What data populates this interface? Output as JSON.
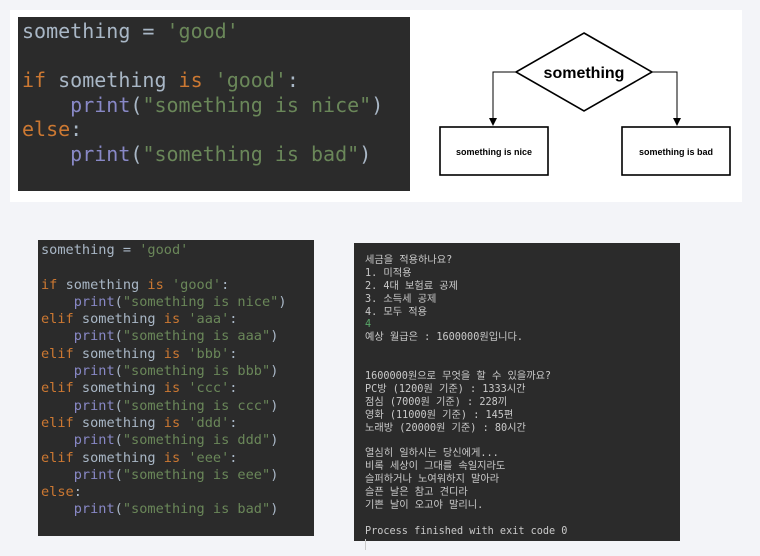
{
  "colors": {
    "keyword": "#cc7832",
    "string": "#6a8759",
    "builtin": "#8888c6",
    "text": "#a9b7c6",
    "code_background": "#2b2b2b",
    "console_input": "#59a869"
  },
  "code_simple": {
    "lines": [
      [
        [
          "plain",
          "something = "
        ],
        [
          "str",
          "'good'"
        ]
      ],
      [],
      [
        [
          "kw",
          "if "
        ],
        [
          "plain",
          "something "
        ],
        [
          "kw",
          "is "
        ],
        [
          "str",
          "'good'"
        ],
        [
          "plain",
          ":"
        ]
      ],
      [
        [
          "plain",
          "    "
        ],
        [
          "call",
          "print"
        ],
        [
          "plain",
          "("
        ],
        [
          "str",
          "\"something is nice\""
        ],
        [
          "plain",
          ")"
        ]
      ],
      [
        [
          "kw",
          "else"
        ],
        [
          "plain",
          ":"
        ]
      ],
      [
        [
          "plain",
          "    "
        ],
        [
          "call",
          "print"
        ],
        [
          "plain",
          "("
        ],
        [
          "str",
          "\"something is bad\""
        ],
        [
          "plain",
          ")"
        ]
      ]
    ]
  },
  "flowchart": {
    "decision": "something",
    "left_box": "something is nice",
    "right_box": "something is bad"
  },
  "code_elif": {
    "lines": [
      [
        [
          "plain",
          "something = "
        ],
        [
          "str",
          "'good'"
        ]
      ],
      [],
      [
        [
          "kw",
          "if "
        ],
        [
          "plain",
          "something "
        ],
        [
          "kw",
          "is "
        ],
        [
          "str",
          "'good'"
        ],
        [
          "plain",
          ":"
        ]
      ],
      [
        [
          "plain",
          "    "
        ],
        [
          "call",
          "print"
        ],
        [
          "plain",
          "("
        ],
        [
          "str",
          "\"something is nice\""
        ],
        [
          "plain",
          ")"
        ]
      ],
      [
        [
          "kw",
          "elif "
        ],
        [
          "plain",
          "something "
        ],
        [
          "kw",
          "is "
        ],
        [
          "str",
          "'aaa'"
        ],
        [
          "plain",
          ":"
        ]
      ],
      [
        [
          "plain",
          "    "
        ],
        [
          "call",
          "print"
        ],
        [
          "plain",
          "("
        ],
        [
          "str",
          "\"something is aaa\""
        ],
        [
          "plain",
          ")"
        ]
      ],
      [
        [
          "kw",
          "elif "
        ],
        [
          "plain",
          "something "
        ],
        [
          "kw",
          "is "
        ],
        [
          "str",
          "'bbb'"
        ],
        [
          "plain",
          ":"
        ]
      ],
      [
        [
          "plain",
          "    "
        ],
        [
          "call",
          "print"
        ],
        [
          "plain",
          "("
        ],
        [
          "str",
          "\"something is bbb\""
        ],
        [
          "plain",
          ")"
        ]
      ],
      [
        [
          "kw",
          "elif "
        ],
        [
          "plain",
          "something "
        ],
        [
          "kw",
          "is "
        ],
        [
          "str",
          "'ccc'"
        ],
        [
          "plain",
          ":"
        ]
      ],
      [
        [
          "plain",
          "    "
        ],
        [
          "call",
          "print"
        ],
        [
          "plain",
          "("
        ],
        [
          "str",
          "\"something is ccc\""
        ],
        [
          "plain",
          ")"
        ]
      ],
      [
        [
          "kw",
          "elif "
        ],
        [
          "plain",
          "something "
        ],
        [
          "kw",
          "is "
        ],
        [
          "str",
          "'ddd'"
        ],
        [
          "plain",
          ":"
        ]
      ],
      [
        [
          "plain",
          "    "
        ],
        [
          "call",
          "print"
        ],
        [
          "plain",
          "("
        ],
        [
          "str",
          "\"something is ddd\""
        ],
        [
          "plain",
          ")"
        ]
      ],
      [
        [
          "kw",
          "elif "
        ],
        [
          "plain",
          "something "
        ],
        [
          "kw",
          "is "
        ],
        [
          "str",
          "'eee'"
        ],
        [
          "plain",
          ":"
        ]
      ],
      [
        [
          "plain",
          "    "
        ],
        [
          "call",
          "print"
        ],
        [
          "plain",
          "("
        ],
        [
          "str",
          "\"something is eee\""
        ],
        [
          "plain",
          ")"
        ]
      ],
      [
        [
          "kw",
          "else"
        ],
        [
          "plain",
          ":"
        ]
      ],
      [
        [
          "plain",
          "    "
        ],
        [
          "call",
          "print"
        ],
        [
          "plain",
          "("
        ],
        [
          "str",
          "\"something is bad\""
        ],
        [
          "plain",
          ")"
        ]
      ]
    ]
  },
  "console": {
    "lines": [
      "세금을 적용하나요?",
      "1. 미적용",
      "2. 4대 보험료 공제",
      "3. 소득세 공제",
      "4. 모두 적용",
      "4",
      "예상 월급은 : 1600000원입니다.",
      "",
      "",
      "1600000원으로 무엇을 할 수 있을까요?",
      "PC방 (1200원 기준) : 1333시간",
      "점심 (7000원 기준) : 228끼",
      "영화 (11000원 기준) : 145편",
      "노래방 (20000원 기준) : 80시간",
      "",
      "열심히 일하시는 당신에게...",
      "비록 세상이 그대를 속일지라도",
      "슬퍼하거나 노여워하지 말아라",
      "슬픈 날은 참고 견디라",
      "기쁜 날이 오고야 말리니.",
      "",
      "Process finished with exit code 0"
    ]
  }
}
